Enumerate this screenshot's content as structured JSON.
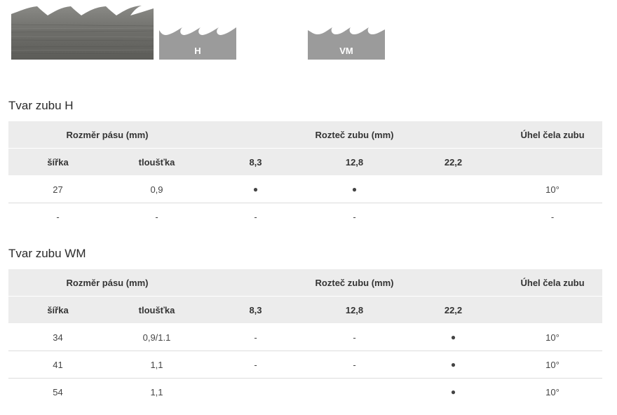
{
  "profiles": {
    "h_label": "H",
    "vm_label": "VM"
  },
  "tables": [
    {
      "title": "Tvar zubu H",
      "header_group": {
        "size": "Rozměr pásu (mm)",
        "pitch": "Rozteč zubu (mm)",
        "angle": "Úhel čela zubu"
      },
      "header_sub": {
        "width": "šířka",
        "thickness": "tloušťka",
        "p1": "8,3",
        "p2": "12,8",
        "p3": "22,2"
      },
      "rows": [
        {
          "width": "27",
          "thickness": "0,9",
          "p1": "●",
          "p2": "●",
          "p3": "",
          "angle": "10°"
        },
        {
          "width": "-",
          "thickness": "-",
          "p1": "-",
          "p2": "-",
          "p3": "",
          "angle": "-"
        }
      ]
    },
    {
      "title": "Tvar zubu WM",
      "header_group": {
        "size": "Rozměr pásu (mm)",
        "pitch": "Rozteč zubu (mm)",
        "angle": "Úhel čela zubu"
      },
      "header_sub": {
        "width": "šířka",
        "thickness": "tloušťka",
        "p1": "8,3",
        "p2": "12,8",
        "p3": "22,2"
      },
      "rows": [
        {
          "width": "34",
          "thickness": "0,9/1.1",
          "p1": "-",
          "p2": "-",
          "p3": "●",
          "angle": "10°"
        },
        {
          "width": "41",
          "thickness": "1,1",
          "p1": "-",
          "p2": "-",
          "p3": "●",
          "angle": "10°"
        },
        {
          "width": "54",
          "thickness": "1,1",
          "p1": "",
          "p2": "",
          "p3": "●",
          "angle": "10°"
        }
      ]
    }
  ]
}
